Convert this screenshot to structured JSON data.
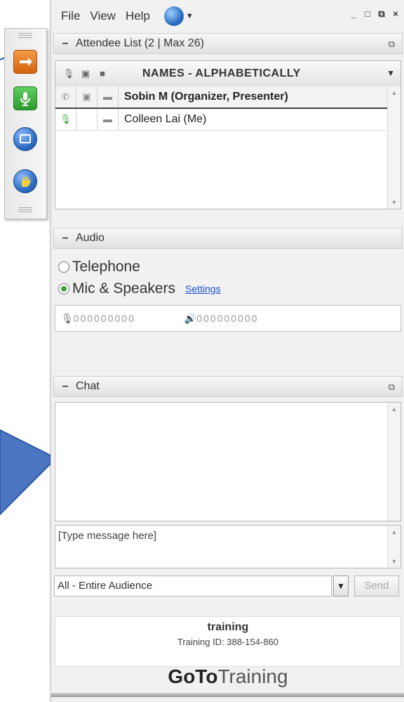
{
  "menubar": {
    "file": "File",
    "view": "View",
    "help": "Help"
  },
  "window_controls": {
    "minimize": "_",
    "maximize": "□",
    "restore": "⧉",
    "close": "×"
  },
  "attendee_section": {
    "title": "Attendee List  (2 | Max 26)",
    "sort_label": "NAMES - ALPHABETICALLY",
    "attendees": [
      {
        "name": "Sobin M (Organizer, Presenter)"
      },
      {
        "name": "Colleen Lai (Me)"
      }
    ]
  },
  "audio_section": {
    "title": "Audio",
    "options": [
      {
        "label": "Telephone",
        "selected": false
      },
      {
        "label": "Mic & Speakers",
        "selected": true
      }
    ],
    "settings_link": "Settings",
    "mic_level": "000000000",
    "speaker_level": "000000000"
  },
  "chat_section": {
    "title": "Chat",
    "input_placeholder": "[Type message here]",
    "recipient": "All - Entire Audience",
    "send_label": "Send"
  },
  "session": {
    "name": "training",
    "id_text": "Training ID: 388-154-860"
  },
  "brand": {
    "bold": "GoTo",
    "light": "Training"
  },
  "colors": {
    "accent_green": "#3aa63a",
    "accent_orange": "#e87b24",
    "accent_blue": "#2f6fc6",
    "link_blue": "#1c4fc7",
    "callout_blue": "#3d6ab8"
  }
}
